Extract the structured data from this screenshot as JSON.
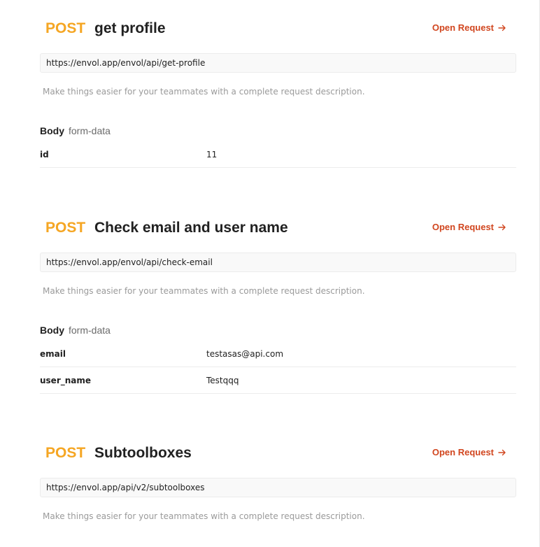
{
  "requests": [
    {
      "method": "POST",
      "title": "get profile",
      "open_label": "Open Request",
      "url": "https://envol.app/envol/api/get-profile",
      "description": "Make things easier for your teammates with a complete request description.",
      "body_label": "Body",
      "body_type": "form-data",
      "params": [
        {
          "key": "id",
          "value": "11"
        }
      ]
    },
    {
      "method": "POST",
      "title": "Check email and user name",
      "open_label": "Open Request",
      "url": "https://envol.app/envol/api/check-email",
      "description": "Make things easier for your teammates with a complete request description.",
      "body_label": "Body",
      "body_type": "form-data",
      "params": [
        {
          "key": "email",
          "value": "testasas@api.com"
        },
        {
          "key": "user_name",
          "value": "Testqqq"
        }
      ]
    },
    {
      "method": "POST",
      "title": "Subtoolboxes",
      "open_label": "Open Request",
      "url": "https://envol.app/api/v2/subtoolboxes",
      "description": "Make things easier for your teammates with a complete request description."
    }
  ],
  "colors": {
    "method": "#f5a623",
    "link": "#d1461f"
  },
  "icons": {
    "open_request": "arrow-right-icon"
  }
}
